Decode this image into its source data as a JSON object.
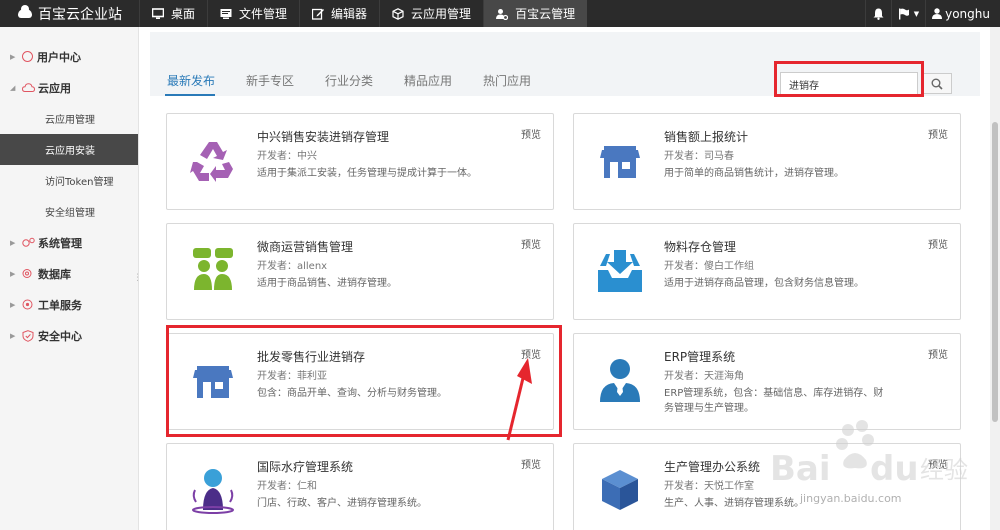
{
  "brand": {
    "title": "百宝云企业站"
  },
  "nav": [
    {
      "label": "桌面",
      "icon": "monitor-icon"
    },
    {
      "label": "文件管理",
      "icon": "document-icon"
    },
    {
      "label": "编辑器",
      "icon": "edit-icon"
    },
    {
      "label": "云应用管理",
      "icon": "cube-icon"
    },
    {
      "label": "百宝云管理",
      "icon": "users-cog-icon"
    }
  ],
  "topright": {
    "user": "yonghu"
  },
  "sidebar": {
    "cat_user": "用户中心",
    "cat_cloud": "云应用",
    "sub": [
      "云应用管理",
      "云应用安装",
      "访问Token管理",
      "安全组管理"
    ],
    "cat_system": "系统管理",
    "cat_db": "数据库",
    "cat_ticket": "工单服务",
    "cat_security": "安全中心"
  },
  "tabs": [
    "最新发布",
    "新手专区",
    "行业分类",
    "精品应用",
    "热门应用"
  ],
  "search": {
    "value": "进销存"
  },
  "cards": [
    {
      "name": "中兴销售安装进销存管理",
      "dev": "开发者：中兴",
      "desc": "适用于集派工安装，任务管理与提成计算于一体。",
      "preview": "预览",
      "icon": "recycle-icon"
    },
    {
      "name": "销售额上报统计",
      "dev": "开发者：司马春",
      "desc": "用于简单的商品销售统计，进销存管理。",
      "preview": "预览",
      "icon": "store-icon"
    },
    {
      "name": "微商运营销售管理",
      "dev": "开发者：allenx",
      "desc": "适用于商品销售、进销存管理。",
      "preview": "预览",
      "icon": "people-chat-icon"
    },
    {
      "name": "物料存仓管理",
      "dev": "开发者：傻白工作组",
      "desc": "适用于进销存商品管理，包含财务信息管理。",
      "preview": "预览",
      "icon": "inbox-download-icon"
    },
    {
      "name": "批发零售行业进销存",
      "dev": "开发者：菲利亚",
      "desc": "包含：商品开单、查询、分析与财务管理。",
      "preview": "预览",
      "icon": "store-icon"
    },
    {
      "name": "ERP管理系统",
      "dev": "开发者：天涯海角",
      "desc": "ERP管理系统，包含：基础信息、库存进销存、财务管理与生产管理。",
      "preview": "预览",
      "icon": "businessman-icon"
    },
    {
      "name": "国际水疗管理系统",
      "dev": "开发者：仁和",
      "desc": "门店、行政、客户、进销存管理系统。",
      "preview": "预览",
      "icon": "spa-person-icon"
    },
    {
      "name": "生产管理办公系统",
      "dev": "开发者：天悦工作室",
      "desc": "生产、人事、进销存管理系统。",
      "preview": "预览",
      "icon": "box-icon"
    }
  ],
  "watermark": {
    "line1": "jingyan.baidu.com"
  }
}
